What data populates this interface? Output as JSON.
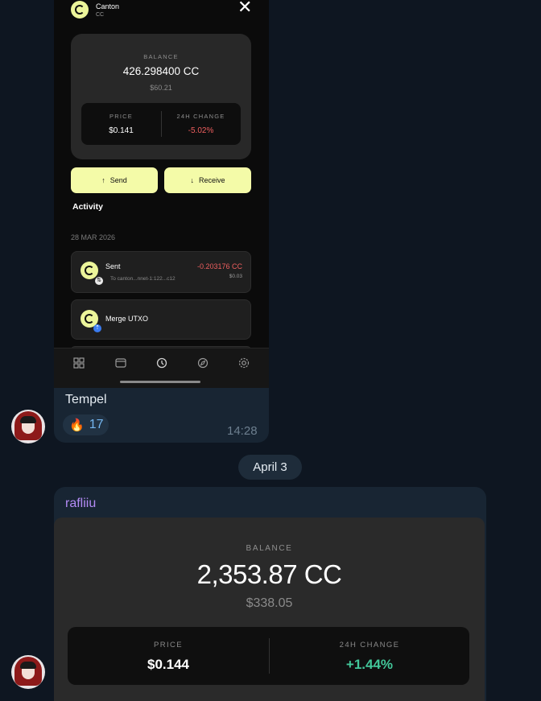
{
  "wallet_screenshot": {
    "header": {
      "name": "Canton",
      "ticker": "CC"
    },
    "balance_label": "BALANCE",
    "balance_amount": "426.298400 CC",
    "balance_usd": "$60.21",
    "price_label": "PRICE",
    "price_value": "$0.141",
    "change_label": "24H CHANGE",
    "change_value": "-5.02%",
    "send_label": "Send",
    "receive_label": "Receive",
    "activity_title": "Activity",
    "activity_date": "28 MAR 2026",
    "activity": [
      {
        "title": "Sent",
        "subtitle": "To canton...nnet-1:122...c12",
        "amount": "-0.203176 CC",
        "usd": "$0.03"
      },
      {
        "title": "Merge UTXO"
      }
    ],
    "nav_icons": [
      "grid-icon",
      "wallet-icon",
      "history-icon",
      "compass-icon",
      "settings-icon"
    ]
  },
  "message1": {
    "caption": "Tempel",
    "reaction": {
      "emoji": "🔥",
      "count": "17"
    },
    "time": "14:28"
  },
  "date_separator": "April 3",
  "message2": {
    "sender": "rafliiu",
    "balance_label": "BALANCE",
    "balance_amount": "2,353.87 CC",
    "balance_usd": "$338.05",
    "price_label": "PRICE",
    "price_value": "$0.144",
    "change_label": "24H CHANGE",
    "change_value": "+1.44%"
  },
  "colors": {
    "chat_bg": "#0e1621",
    "bubble_bg": "#182533",
    "accent_yellow": "#f4fba8",
    "negative": "#ef5f5f",
    "positive": "#42c79a",
    "sender_name": "#b38bf5"
  }
}
